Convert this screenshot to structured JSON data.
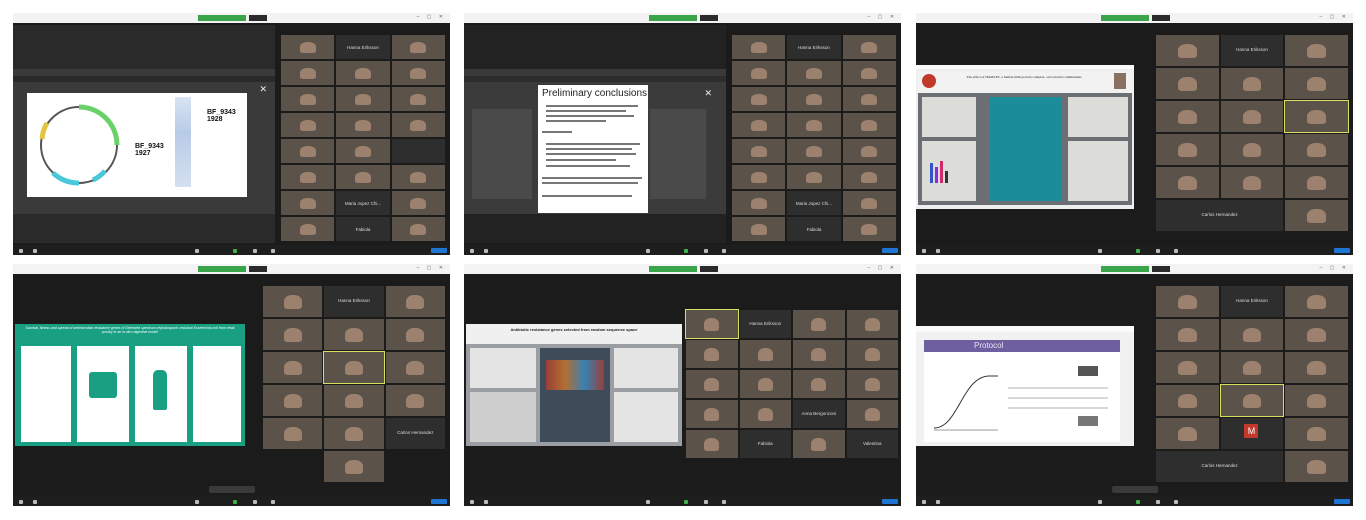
{
  "panels": [
    {
      "id": 1,
      "shared_content": "plasmid-figure",
      "labels": {
        "bf1927": "BF_9343\n1927",
        "bf1928": "BF_9343\n1928"
      },
      "participants": [
        "Hanna Eriksson",
        "Maria Jopez Chi...",
        "Fabiola"
      ]
    },
    {
      "id": 2,
      "shared_content": "slide",
      "slide_title": "Preliminary conclusions",
      "participants": [
        "Hanna Eriksson",
        "Maria Jopez Chi...",
        "Fabiola"
      ]
    },
    {
      "id": 3,
      "shared_content": "poster",
      "poster_title": "The effect of HAMLET, a human milk protein complex, on bacterial communities",
      "participants": [
        "Hanna Eriksson",
        "Carlos Hernandez"
      ]
    },
    {
      "id": 4,
      "shared_content": "poster",
      "poster_title": "Survival, fitness and spread of antimicrobial resistance genes of Extended spectrum cephalosporin-resistant Escherichia coli from retail poultry in an in vitro digestive model",
      "participants": [
        "Hanna Eriksson",
        "Carlos Hernandez"
      ]
    },
    {
      "id": 5,
      "shared_content": "poster",
      "poster_title": "Antibiotic resistance genes selected from random sequence space",
      "participants": [
        "Hanna Eriksson",
        "Anna Bergonzoni",
        "Fabiola",
        "Valentina"
      ]
    },
    {
      "id": 6,
      "shared_content": "slide",
      "slide_title": "Protocol",
      "participants": [
        "Hanna Eriksson",
        "Carlos Hernandez"
      ],
      "avatar_letter": "M"
    }
  ],
  "colors": {
    "zoom_bg": "#1b1b1b",
    "viewing_green": "#3aa44a",
    "leave_blue": "#1f75d1",
    "poster_green": "#19a082",
    "poster_gray": "#6b6f73",
    "slide_purple": "#6e5fa0"
  }
}
